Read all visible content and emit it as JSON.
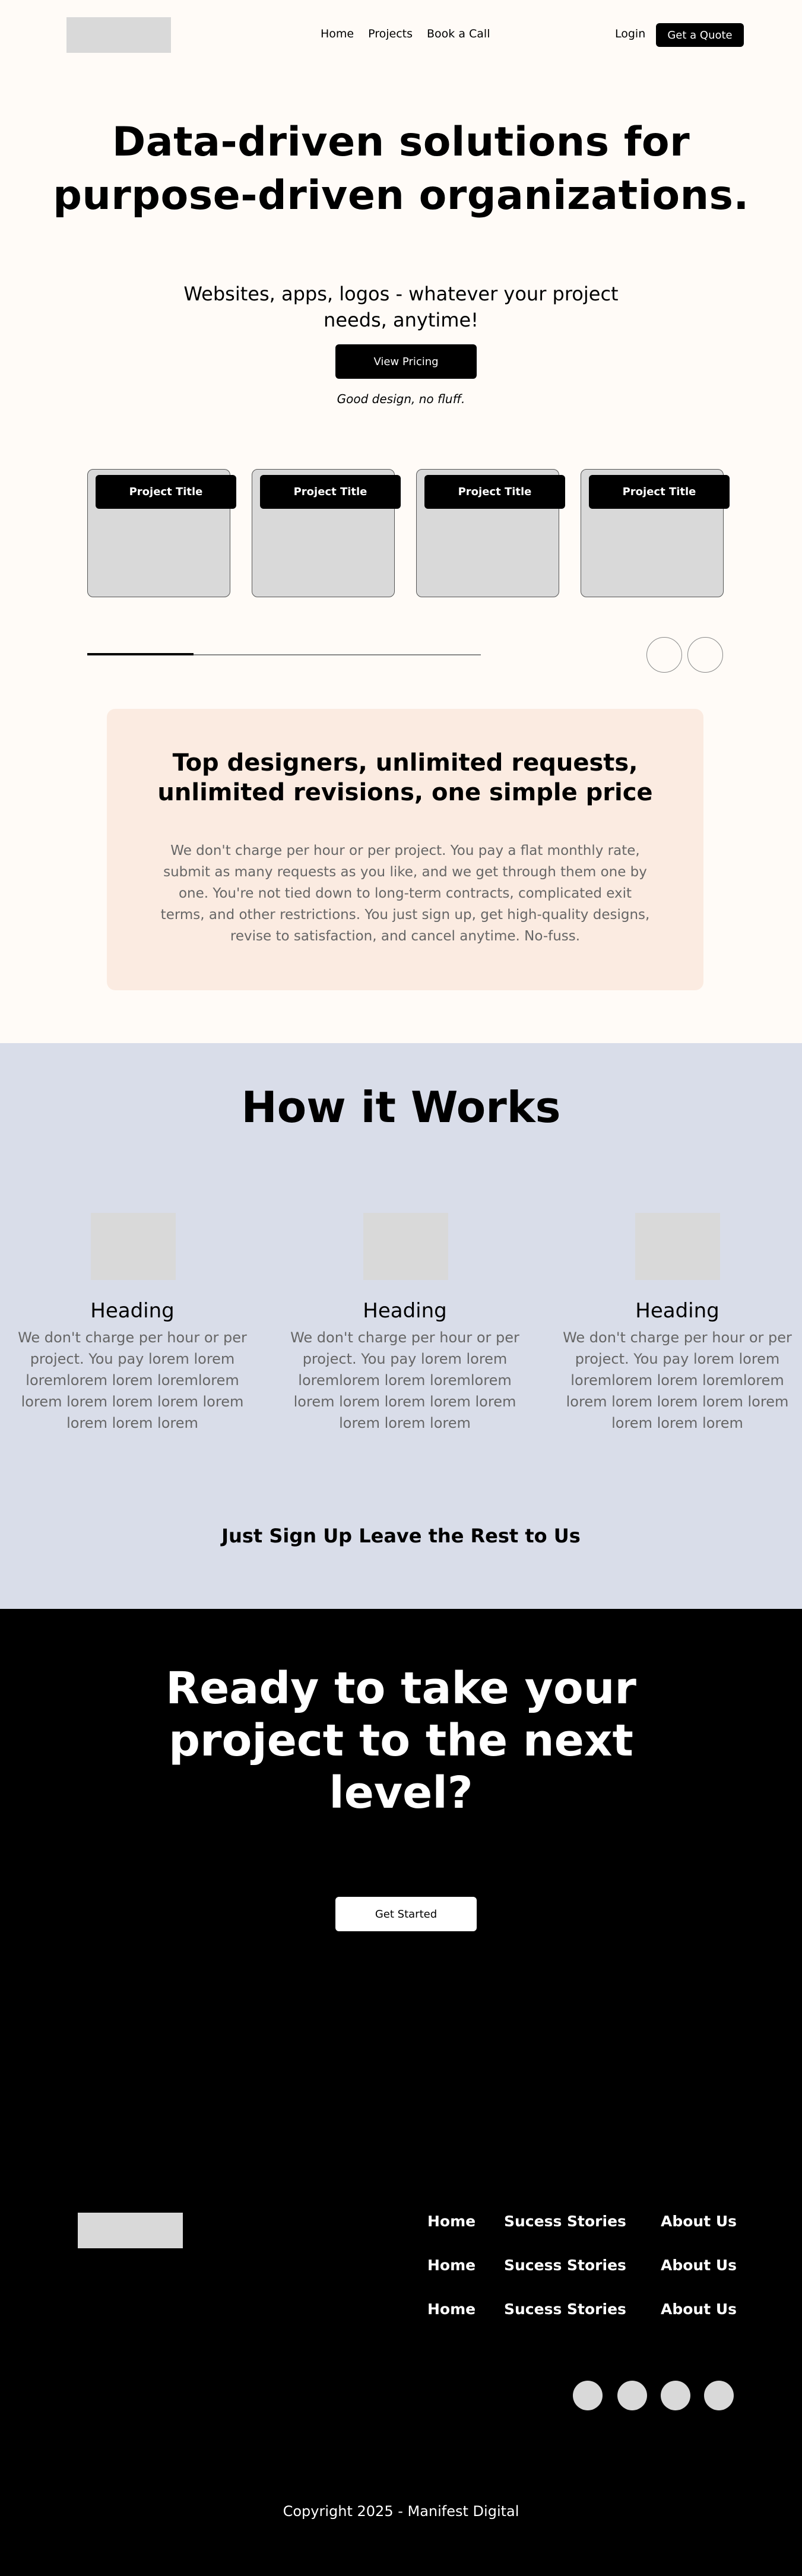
{
  "header": {
    "nav": [
      "Home",
      "Projects",
      "Book a Call"
    ],
    "login": "Login",
    "quote_button": "Get a Quote"
  },
  "hero": {
    "title_line1": "Data-driven solutions for",
    "title_line2": "purpose-driven organizations.",
    "subtitle": "Websites, apps, logos - whatever your project needs, anytime!",
    "pricing_button": "View Pricing",
    "tagline": "Good design, no fluff."
  },
  "projects": {
    "cards": [
      {
        "title": "Project Title"
      },
      {
        "title": "Project Title"
      },
      {
        "title": "Project Title"
      },
      {
        "title": "Project Title"
      }
    ],
    "progress": 0.27
  },
  "pricing": {
    "title": "Top designers, unlimited requests, unlimited revisions, one simple price",
    "text": "We don't charge per hour or per project. You pay a flat monthly rate, submit as many requests as you like, and we get through them one by one. You're not tied down to long-term contracts, complicated exit terms, and other restrictions. You just sign up, get high-quality designs, revise to satisfaction, and cancel anytime. No-fuss."
  },
  "how": {
    "title": "How it Works",
    "steps": [
      {
        "heading": "Heading",
        "text": "We don't charge per hour or per project. You pay lorem lorem loremlorem lorem loremlorem lorem lorem lorem lorem lorem lorem lorem lorem"
      },
      {
        "heading": "Heading",
        "text": "We don't charge per hour or per project. You pay lorem lorem loremlorem lorem loremlorem lorem lorem lorem lorem lorem lorem lorem lorem"
      },
      {
        "heading": "Heading",
        "text": "We don't charge per hour or per project. You pay lorem lorem loremlorem lorem loremlorem lorem lorem lorem lorem lorem lorem lorem lorem"
      }
    ],
    "signup_line": "Just Sign Up Leave the Rest to Us"
  },
  "cta": {
    "title": "Ready to take your project to the next level?",
    "button": "Get Started"
  },
  "footer": {
    "links": [
      [
        "Home",
        "Sucess Stories",
        "About Us"
      ],
      [
        "Home",
        "Sucess Stories",
        "About Us"
      ],
      [
        "Home",
        "Sucess Stories",
        "About Us"
      ]
    ],
    "copyright": "Copyright 2025 - Manifest Digital"
  }
}
